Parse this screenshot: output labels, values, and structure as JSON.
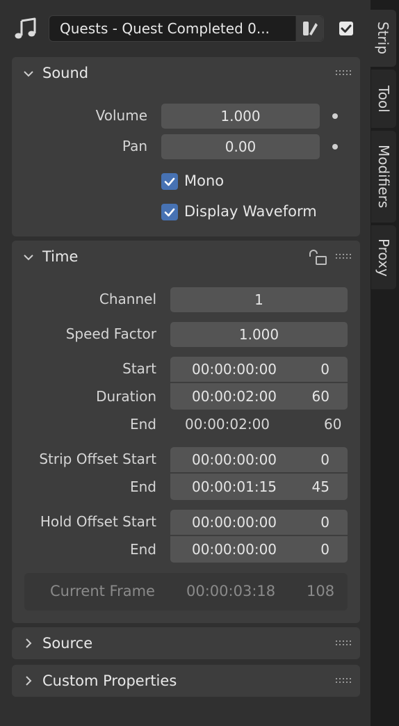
{
  "tabs": [
    {
      "label": "Strip",
      "active": true
    },
    {
      "label": "Tool",
      "active": false
    },
    {
      "label": "Modifiers",
      "active": false
    },
    {
      "label": "Proxy",
      "active": false
    }
  ],
  "header": {
    "strip_type_icon": "music-note-icon",
    "strip_name": "Quests - Quest Completed 0...",
    "color_tag_icon": "color-tag-icon",
    "enabled": true
  },
  "sound_panel": {
    "title": "Sound",
    "volume_label": "Volume",
    "volume_value": "1.000",
    "pan_label": "Pan",
    "pan_value": "0.00",
    "mono_label": "Mono",
    "mono_checked": true,
    "waveform_label": "Display Waveform",
    "waveform_checked": true
  },
  "time_panel": {
    "title": "Time",
    "lock_icon": "unlock-icon",
    "channel_label": "Channel",
    "channel_value": "1",
    "speed_label": "Speed Factor",
    "speed_value": "1.000",
    "start_label": "Start",
    "start_tc": "00:00:00:00",
    "start_frames": "0",
    "duration_label": "Duration",
    "duration_tc": "00:00:02:00",
    "duration_frames": "60",
    "end_label": "End",
    "end_tc": "00:00:02:00",
    "end_frames": "60",
    "strip_offset_start_label": "Strip Offset Start",
    "strip_offset_start_tc": "00:00:00:00",
    "strip_offset_start_frames": "0",
    "strip_offset_end_label": "End",
    "strip_offset_end_tc": "00:00:01:15",
    "strip_offset_end_frames": "45",
    "hold_offset_start_label": "Hold Offset Start",
    "hold_offset_start_tc": "00:00:00:00",
    "hold_offset_start_frames": "0",
    "hold_offset_end_label": "End",
    "hold_offset_end_tc": "00:00:00:00",
    "hold_offset_end_frames": "0",
    "current_frame_label": "Current Frame",
    "current_frame_tc": "00:00:03:18",
    "current_frame_frames": "108"
  },
  "source_panel": {
    "title": "Source"
  },
  "custom_props_panel": {
    "title": "Custom Properties"
  },
  "colors": {
    "background": "#303030",
    "panel": "#3d3d3d",
    "field": "#545454",
    "checkbox": "#4772b3"
  }
}
